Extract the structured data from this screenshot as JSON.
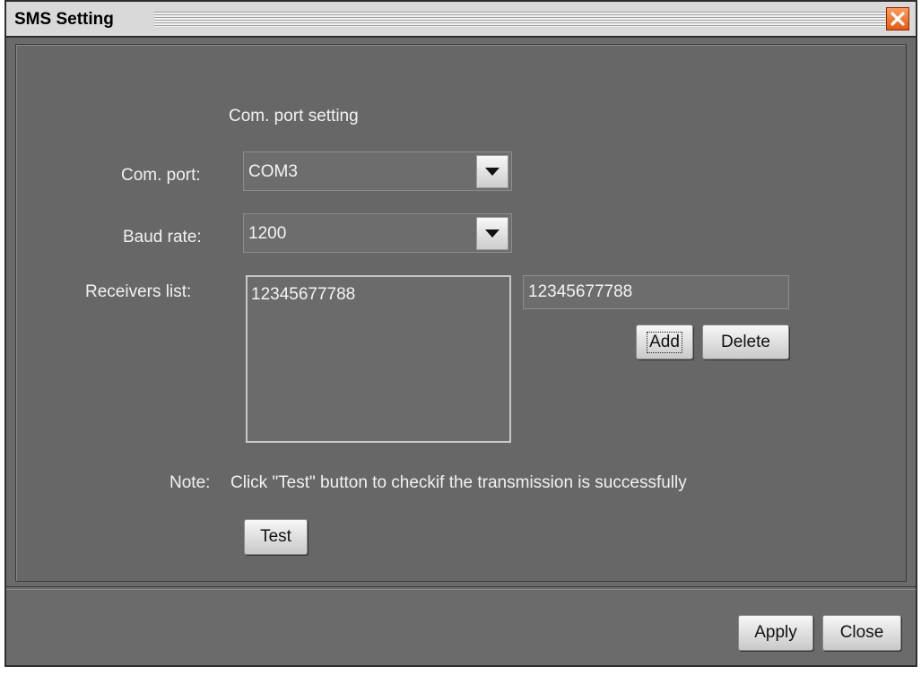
{
  "window": {
    "title": "SMS Setting",
    "close_icon": "close-x-icon"
  },
  "section": {
    "heading": "Com. port setting"
  },
  "com_port": {
    "label": "Com. port:",
    "selected": "COM3"
  },
  "baud_rate": {
    "label": "Baud rate:",
    "selected": "1200"
  },
  "receivers": {
    "label": "Receivers list:",
    "items": [
      "12345677788"
    ],
    "input_value": "12345677788",
    "add_label": "Add",
    "delete_label": "Delete"
  },
  "note": {
    "label": "Note:",
    "text": "Click \"Test\" button to checkif the transmission is successfully"
  },
  "test_label": "Test",
  "footer": {
    "apply_label": "Apply",
    "close_label": "Close"
  },
  "colors": {
    "background": "#6b6b6b",
    "close_button": "#e35a14",
    "text": "#f2f2f2"
  }
}
